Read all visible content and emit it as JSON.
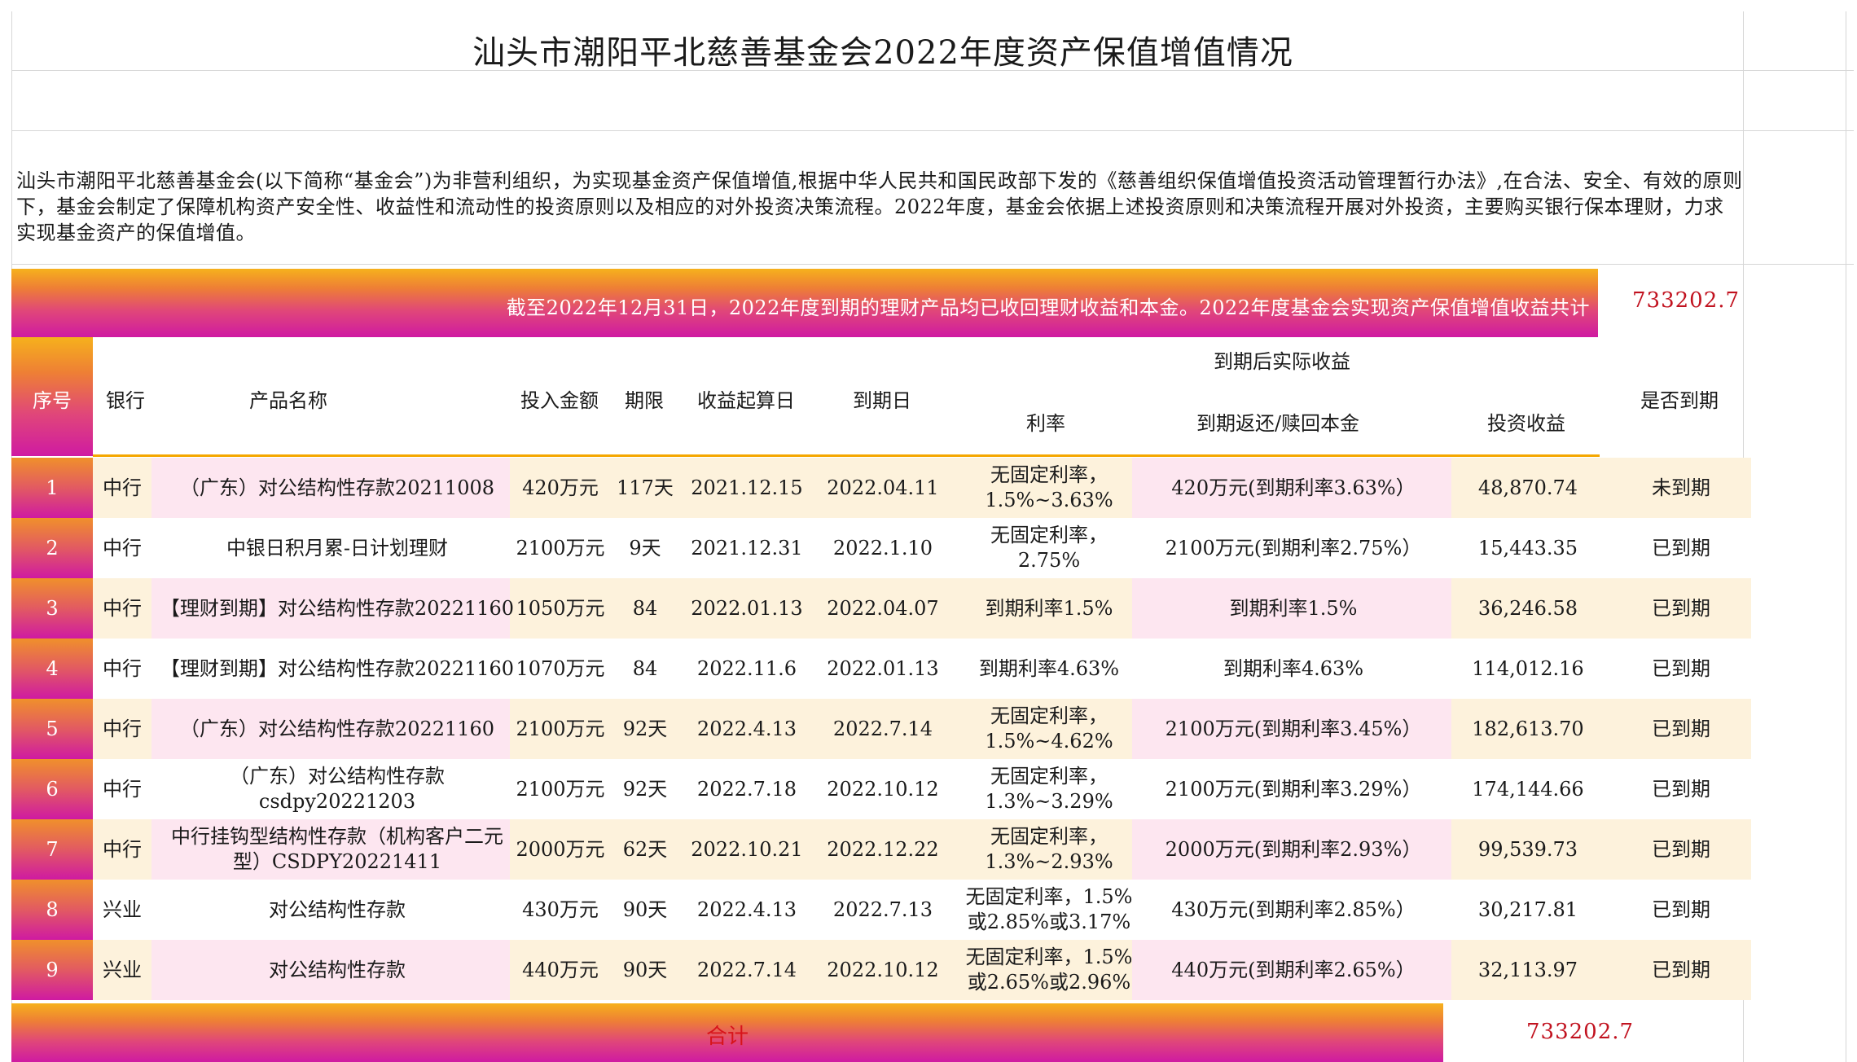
{
  "title": "汕头市潮阳平北慈善基金会2022年度资产保值增值情况",
  "intro": "汕头市潮阳平北慈善基金会(以下简称“基金会”)为非营利组织，为实现基金资产保值增值,根据中华人民共和国民政部下发的《慈善组织保值增值投资活动管理暂行办法》,在合法、安全、有效的原则下，基金会制定了保障机构资产安全性、收益性和流动性的投资原则以及相应的对外投资决策流程。2022年度，基金会依据上述投资原则和决策流程开展对外投资，主要购买银行保本理财，力求实现基金资产的保值增值。",
  "banner": {
    "text": "截至2022年12月31日，2022年度到期的理财产品均已收回理财收益和本金。2022年度基金会实现资产保值增值收益共计",
    "total": "733202.7"
  },
  "headers": {
    "seq": "序号",
    "bank": "银行",
    "product": "产品名称",
    "amount": "投入金额",
    "term": "期限",
    "start": "收益起算日",
    "end": "到期日",
    "group": "到期后实际收益",
    "rate": "利率",
    "principal": "到期返还/赎回本金",
    "income": "投资收益",
    "status": "是否到期"
  },
  "rows": [
    {
      "seq": "1",
      "bank": "中行",
      "product": "（广东）对公结构性存款20211008",
      "amount": "420万元",
      "term": "117天",
      "start": "2021.12.15",
      "end": "2022.04.11",
      "rate": "无固定利率，1.5%~3.63%",
      "principal": "420万元(到期利率3.63%）",
      "income": "48,870.74",
      "status": "未到期"
    },
    {
      "seq": "2",
      "bank": "中行",
      "product": "中银日积月累-日计划理财",
      "amount": "2100万元",
      "term": "9天",
      "start": "2021.12.31",
      "end": "2022.1.10",
      "rate": "无固定利率，2.75%",
      "principal": "2100万元(到期利率2.75%）",
      "income": "15,443.35",
      "status": "已到期"
    },
    {
      "seq": "3",
      "bank": "中行",
      "product": "【理财到期】对公结构性存款20221160",
      "amount": "1050万元",
      "term": "84",
      "start": "2022.01.13",
      "end": "2022.04.07",
      "rate": "到期利率1.5%",
      "principal": "到期利率1.5%",
      "income": "36,246.58",
      "status": "已到期"
    },
    {
      "seq": "4",
      "bank": "中行",
      "product": "【理财到期】对公结构性存款20221160",
      "amount": "1070万元",
      "term": "84",
      "start": "2022.11.6",
      "end": "2022.01.13",
      "rate": "到期利率4.63%",
      "principal": "到期利率4.63%",
      "income": "114,012.16",
      "status": "已到期"
    },
    {
      "seq": "5",
      "bank": "中行",
      "product": "（广东）对公结构性存款20221160",
      "amount": "2100万元",
      "term": "92天",
      "start": "2022.4.13",
      "end": "2022.7.14",
      "rate": "无固定利率，1.5%~4.62%",
      "principal": "2100万元(到期利率3.45%）",
      "income": "182,613.70",
      "status": "已到期"
    },
    {
      "seq": "6",
      "bank": "中行",
      "product": "（广东）对公结构性存款csdpy20221203",
      "amount": "2100万元",
      "term": "92天",
      "start": "2022.7.18",
      "end": "2022.10.12",
      "rate": "无固定利率，1.3%~3.29%",
      "principal": "2100万元(到期利率3.29%）",
      "income": "174,144.66",
      "status": "已到期"
    },
    {
      "seq": "7",
      "bank": "中行",
      "product": "中行挂钩型结构性存款（机构客户二元型）CSDPY20221411",
      "amount": "2000万元",
      "term": "62天",
      "start": "2022.10.21",
      "end": "2022.12.22",
      "rate": "无固定利率，1.3%~2.93%",
      "principal": "2000万元(到期利率2.93%）",
      "income": "99,539.73",
      "status": "已到期"
    },
    {
      "seq": "8",
      "bank": "兴业",
      "product": "对公结构性存款",
      "amount": "430万元",
      "term": "90天",
      "start": "2022.4.13",
      "end": "2022.7.13",
      "rate": "无固定利率，1.5%或2.85%或3.17%",
      "principal": "430万元(到期利率2.85%）",
      "income": "30,217.81",
      "status": "已到期"
    },
    {
      "seq": "9",
      "bank": "兴业",
      "product": "对公结构性存款",
      "amount": "440万元",
      "term": "90天",
      "start": "2022.7.14",
      "end": "2022.10.12",
      "rate": "无固定利率，1.5%或2.65%或2.96%",
      "principal": "440万元(到期利率2.65%）",
      "income": "32,113.97",
      "status": "已到期"
    }
  ],
  "footer": {
    "label": "合计",
    "total": "733202.7"
  },
  "colors": {
    "gradient_top": "#f6b11c",
    "gradient_bottom": "#cf1aa2",
    "total_red": "#c1121f",
    "row_band": "#fdf2dc",
    "pink_cell": "#fde6f0"
  }
}
